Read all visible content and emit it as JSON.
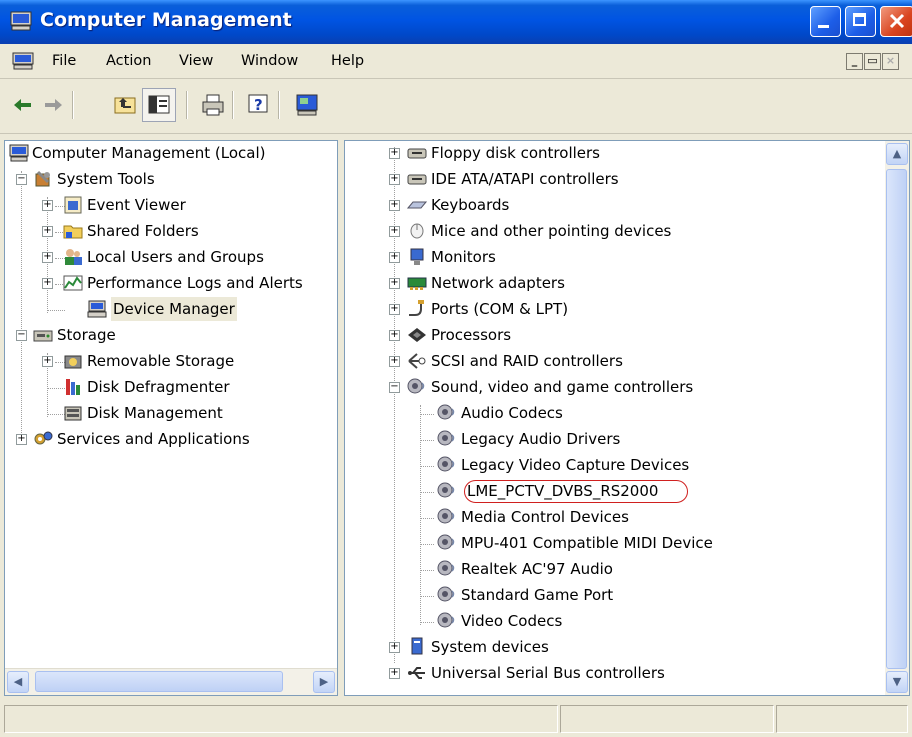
{
  "window": {
    "title": "Computer Management"
  },
  "menu": {
    "items": [
      "File",
      "Action",
      "View",
      "Window",
      "Help"
    ]
  },
  "toolbar": {
    "buttons": [
      "back-icon",
      "forward-icon",
      "up-one-level-icon",
      "show-hide-tree-icon",
      "print-icon",
      "help-icon",
      "console-icon"
    ]
  },
  "left_tree": {
    "root": "Computer Management (Local)",
    "system_tools": "System Tools",
    "event_viewer": "Event Viewer",
    "shared_folders": "Shared Folders",
    "local_users": "Local Users and Groups",
    "perf_logs": "Performance Logs and Alerts",
    "device_manager": "Device Manager",
    "storage": "Storage",
    "removable_storage": "Removable Storage",
    "disk_defrag": "Disk Defragmenter",
    "disk_mgmt": "Disk Management",
    "services_apps": "Services and Applications"
  },
  "right_tree": {
    "categories": [
      "Floppy disk controllers",
      "IDE ATA/ATAPI controllers",
      "Keyboards",
      "Mice and other pointing devices",
      "Monitors",
      "Network adapters",
      "Ports (COM & LPT)",
      "Processors",
      "SCSI and RAID controllers",
      "Sound, video and game controllers"
    ],
    "sound_children": [
      "Audio Codecs",
      "Legacy Audio Drivers",
      "Legacy Video Capture Devices",
      "LME_PCTV_DVBS_RS2000",
      "Media Control Devices",
      "MPU-401 Compatible MIDI Device",
      "Realtek AC'97 Audio",
      "Standard Game Port",
      "Video Codecs"
    ],
    "after": [
      "System devices",
      "Universal Serial Bus controllers"
    ]
  },
  "colors": {
    "title_bar": "#0054e3",
    "highlight_oval": "#d0201f",
    "chrome": "#ece9d8"
  }
}
